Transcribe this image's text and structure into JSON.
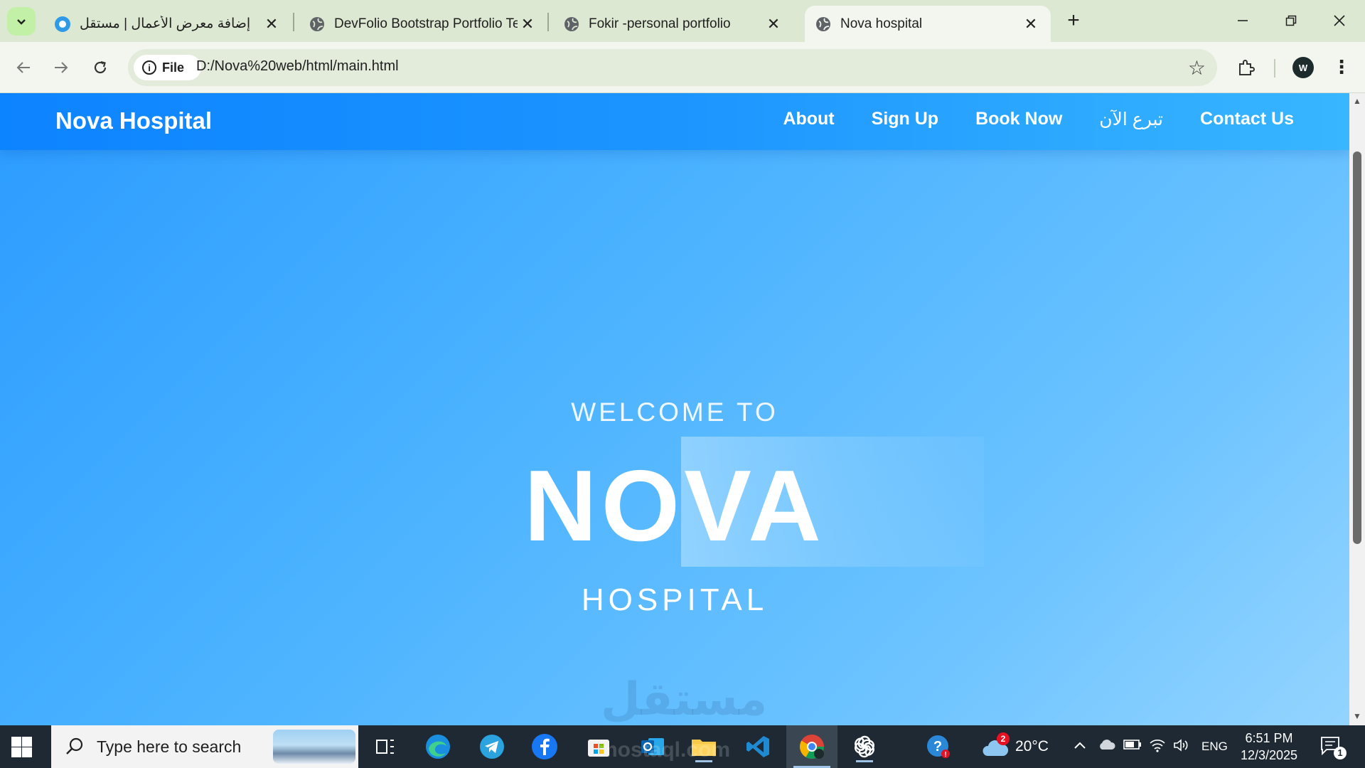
{
  "browser": {
    "tabs": [
      {
        "title": "إضافة معرض الأعمال | مستقل",
        "active": false
      },
      {
        "title": "DevFolio Bootstrap Portfolio Template",
        "active": false
      },
      {
        "title": "Fokir -personal portfolio",
        "active": false
      },
      {
        "title": "Nova hospital",
        "active": true
      }
    ],
    "new_tab_label": "+",
    "site_chip_label": "File",
    "url": "D:/Nova%20web/html/main.html",
    "profile_initial": "W"
  },
  "site": {
    "brand": "Nova Hospital",
    "nav": [
      {
        "label": "About"
      },
      {
        "label": "Sign Up"
      },
      {
        "label": "Book Now"
      },
      {
        "label": "تبرع الآن"
      },
      {
        "label": "Contact Us"
      }
    ],
    "hero": {
      "welcome": "WELCOME TO",
      "title": "NOVA",
      "subtitle": "HOSPITAL"
    },
    "watermark": "مستقل",
    "colors": {
      "nav_start": "#0d84ff",
      "nav_end": "#38b6ff",
      "hero_text": "#ffffff"
    }
  },
  "taskbar": {
    "search_placeholder": "Type here to search",
    "weather": {
      "temp": "20°C",
      "badge": "2"
    },
    "language": "ENG",
    "time": "6:51 PM",
    "date": "12/3/2025",
    "notification_count": "1",
    "watermark": "mostaql.com"
  }
}
